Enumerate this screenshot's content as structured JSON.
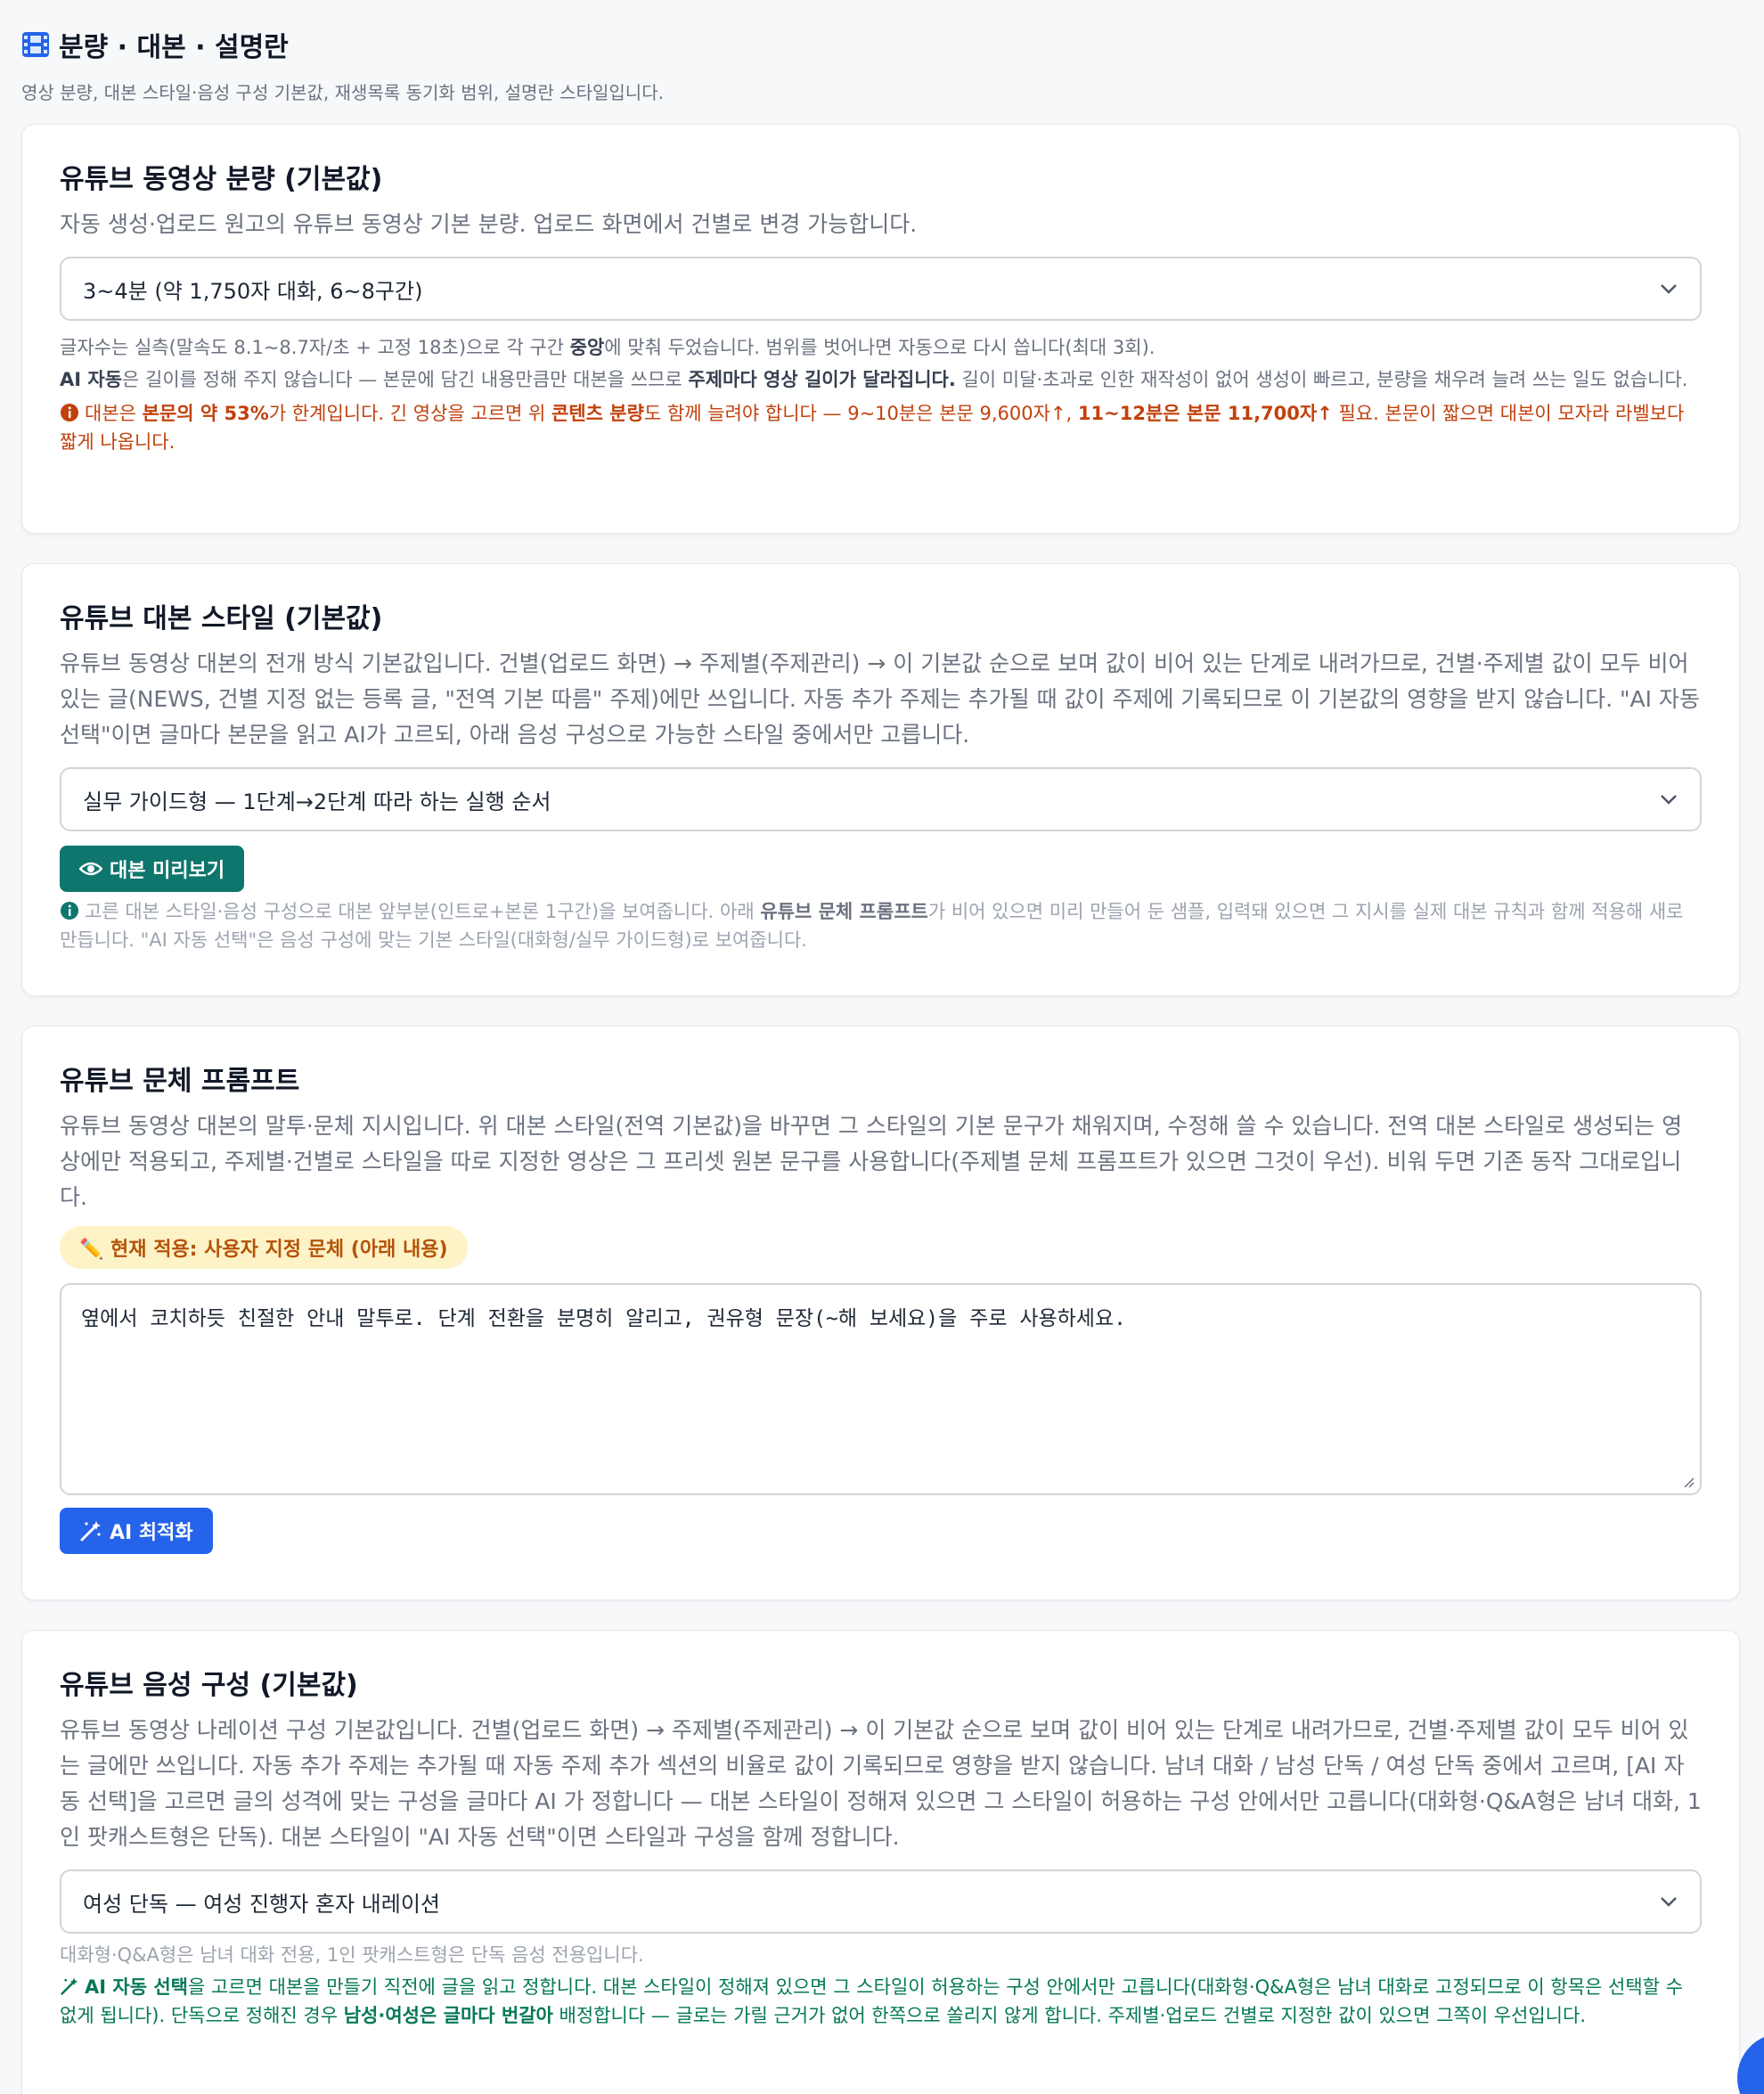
{
  "header": {
    "title": "분량 · 대본 · 설명란",
    "description": "영상 분량, 대본 스타일·음성 구성 기본값, 재생목록 동기화 범위, 설명란 스타일입니다."
  },
  "duration": {
    "title": "유튜브 동영상 분량 (기본값)",
    "description": "자동 생성·업로드 원고의 유튜브 동영상 기본 분량. 업로드 화면에서 건별로 변경 가능합니다.",
    "selected": "3~4분 (약 1,750자 대화, 6~8구간)",
    "note1_a": "글자수는 실측(말속도 8.1~8.7자/초 + 고정 18초)으로 각 구간 ",
    "note1_b": "중앙",
    "note1_c": "에 맞춰 두었습니다. 범위를 벗어나면 자동으로 다시 씁니다(최대 3회).",
    "note2_a": "AI 자동",
    "note2_b": "은 길이를 정해 주지 않습니다 — 본문에 담긴 내용만큼만 대본을 쓰므로 ",
    "note2_c": "주제마다 영상 길이가 달라집니다.",
    "note2_d": " 길이 미달·초과로 인한 재작성이 없어 생성이 빠르고, 분량을 채우려 늘려 쓰는 일도 없습니다.",
    "warn_a": "대본은 ",
    "warn_b": "본문의 약 53%",
    "warn_c": "가 한계입니다. 긴 영상을 고르면 위 ",
    "warn_d": "콘텐츠 분량",
    "warn_e": "도 함께 늘려야 합니다 — 9~10분은 본문 9,600자↑, ",
    "warn_f": "11~12분은 본문 11,700자↑",
    "warn_g": " 필요. 본문이 짧으면 대본이 모자라 라벨보다 짧게 나옵니다."
  },
  "script_style": {
    "title": "유튜브 대본 스타일 (기본값)",
    "description": "유튜브 동영상 대본의 전개 방식 기본값입니다. 건별(업로드 화면) → 주제별(주제관리) → 이 기본값 순으로 보며 값이 비어 있는 단계로 내려가므로, 건별·주제별 값이 모두 비어 있는 글(NEWS, 건별 지정 없는 등록 글, \"전역 기본 따름\" 주제)에만 쓰입니다. 자동 추가 주제는 추가될 때 값이 주제에 기록되므로 이 기본값의 영향을 받지 않습니다. \"AI 자동 선택\"이면 글마다 본문을 읽고 AI가 고르되, 아래 음성 구성으로 가능한 스타일 중에서만 고릅니다.",
    "selected": "실무 가이드형 — 1단계→2단계 따라 하는 실행 순서",
    "preview_button": "대본 미리보기",
    "note_a": "고른 대본 스타일·음성 구성으로 대본 앞부분(인트로+본론 1구간)을 보여줍니다. 아래 ",
    "note_b": "유튜브 문체 프롬프트",
    "note_c": "가 비어 있으면 미리 만들어 둔 샘플, 입력돼 있으면 그 지시를 실제 대본 규칙과 함께 적용해 새로 만듭니다. \"AI 자동 선택\"은 음성 구성에 맞는 기본 스타일(대화형/실무 가이드형)로 보여줍니다."
  },
  "tone_prompt": {
    "title": "유튜브 문체 프롬프트",
    "description": "유튜브 동영상 대본의 말투·문체 지시입니다. 위 대본 스타일(전역 기본값)을 바꾸면 그 스타일의 기본 문구가 채워지며, 수정해 쓸 수 있습니다. 전역 대본 스타일로 생성되는 영상에만 적용되고, 주제별·건별로 스타일을 따로 지정한 영상은 그 프리셋 원본 문구를 사용합니다(주제별 문체 프롬프트가 있으면 그것이 우선). 비워 두면 기존 동작 그대로입니다.",
    "badge": "✏️ 현재 적용: 사용자 지정 문체 (아래 내용)",
    "value": "옆에서 코치하듯 친절한 안내 말투로. 단계 전환을 분명히 알리고, 권유형 문장(~해 보세요)을 주로 사용하세요.",
    "optimize_button": "AI 최적화"
  },
  "voice": {
    "title": "유튜브 음성 구성 (기본값)",
    "description": "유튜브 동영상 나레이션 구성 기본값입니다. 건별(업로드 화면) → 주제별(주제관리) → 이 기본값 순으로 보며 값이 비어 있는 단계로 내려가므로, 건별·주제별 값이 모두 비어 있는 글에만 쓰입니다. 자동 추가 주제는 추가될 때 자동 주제 추가 섹션의 비율로 값이 기록되므로 영향을 받지 않습니다. 남녀 대화 / 남성 단독 / 여성 단독 중에서 고르며, [AI 자동 선택]을 고르면 글의 성격에 맞는 구성을 글마다 AI 가 정합니다 — 대본 스타일이 정해져 있으면 그 스타일이 허용하는 구성 안에서만 고릅니다(대화형·Q&A형은 남녀 대화, 1인 팟캐스트형은 단독). 대본 스타일이 \"AI 자동 선택\"이면 스타일과 구성을 함께 정합니다.",
    "selected": "여성 단독 — 여성 진행자 혼자 내레이션",
    "note1": "대화형·Q&A형은 남녀 대화 전용, 1인 팟캐스트형은 단독 음성 전용입니다.",
    "note2_a": "AI 자동 선택",
    "note2_b": "을 고르면 대본을 만들기 직전에 글을 읽고 정합니다. 대본 스타일이 정해져 있으면 그 스타일이 허용하는 구성 안에서만 고릅니다(대화형·Q&A형은 남녀 대화로 고정되므로 이 항목은 선택할 수 없게 됩니다). 단독으로 정해진 경우 ",
    "note2_c": "남성·여성은 글마다 번갈아",
    "note2_d": " 배정합니다 — 글로는 가릴 근거가 없어 한쪽으로 쏠리지 않게 합니다. 주제별·업로드 건별로 지정한 값이 있으면 그쪽이 우선입니다."
  },
  "colors": {
    "accent_blue": "#2563eb",
    "teal": "#0f766e",
    "warning": "#c2410c",
    "success": "#047857"
  }
}
